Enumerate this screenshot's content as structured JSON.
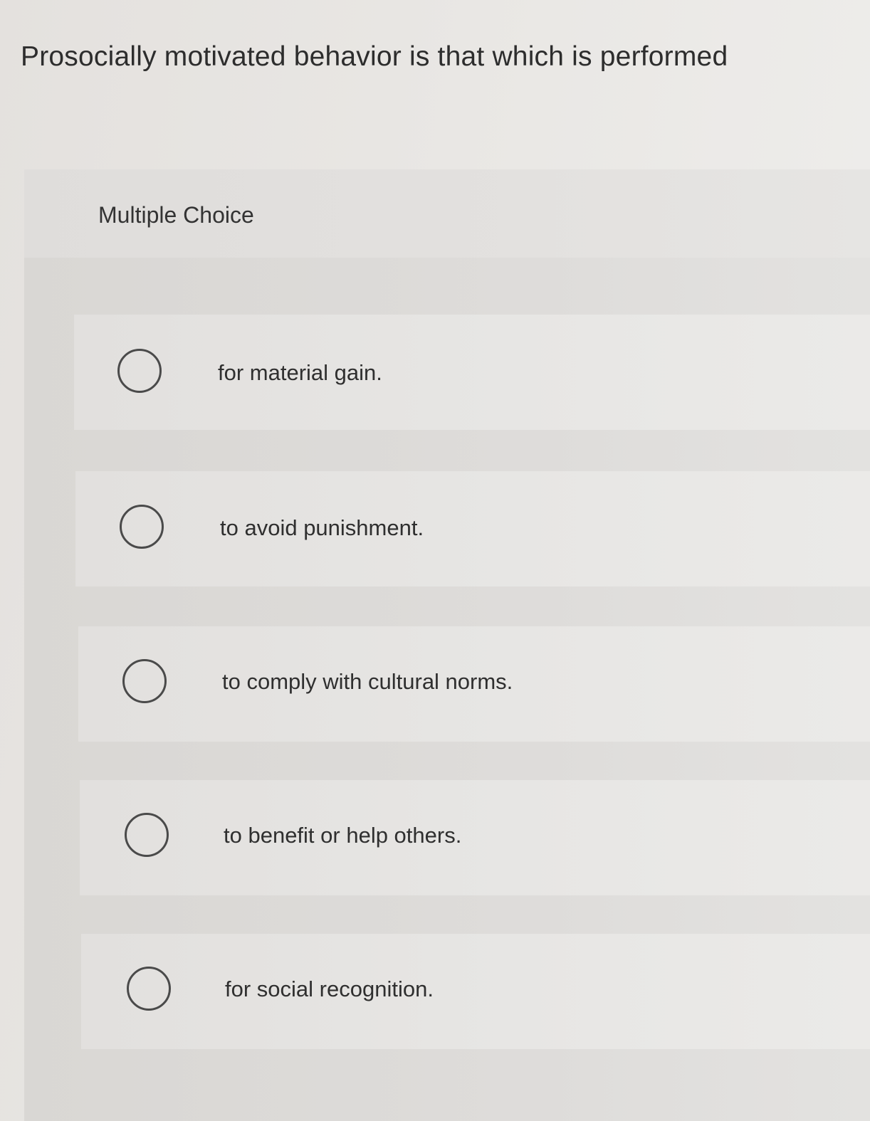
{
  "question": {
    "text": "Prosocially motivated behavior is that which is performed"
  },
  "panel": {
    "type_label": "Multiple Choice"
  },
  "options": [
    {
      "label": "for material gain.",
      "selected": false
    },
    {
      "label": "to avoid punishment.",
      "selected": false
    },
    {
      "label": "to comply with cultural norms.",
      "selected": false
    },
    {
      "label": "to benefit or help others.",
      "selected": false
    },
    {
      "label": "for social recognition.",
      "selected": false
    }
  ]
}
